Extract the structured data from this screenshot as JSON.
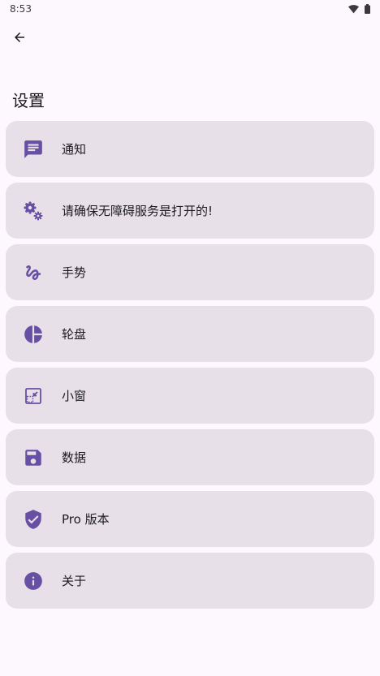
{
  "status_bar": {
    "time": "8:53",
    "wifi_icon": "wifi-icon",
    "battery_icon": "battery-icon"
  },
  "header": {
    "back_icon": "arrow-back-icon",
    "title": "设置"
  },
  "settings": {
    "accent_color": "#6750a4",
    "items": [
      {
        "label": "通知",
        "icon": "message-icon"
      },
      {
        "label": "请确保无障碍服务是打开的!",
        "icon": "gears-icon"
      },
      {
        "label": "手势",
        "icon": "gesture-icon"
      },
      {
        "label": "轮盘",
        "icon": "pie-chart-icon"
      },
      {
        "label": "小窗",
        "icon": "picture-in-picture-icon"
      },
      {
        "label": "数据",
        "icon": "save-icon"
      },
      {
        "label": "Pro 版本",
        "icon": "shield-check-icon"
      },
      {
        "label": "关于",
        "icon": "info-icon"
      }
    ]
  }
}
